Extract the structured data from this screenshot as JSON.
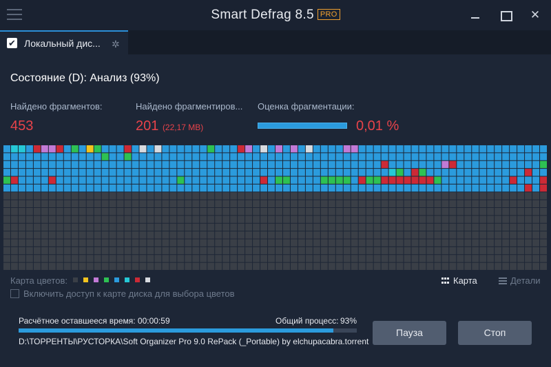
{
  "window": {
    "title": "Smart Defrag 8.5",
    "badge": "PRO",
    "close_glyph": "✕"
  },
  "tab": {
    "label": "Локальный дис...",
    "checked_glyph": "✔",
    "spinner_glyph": "✲"
  },
  "status": "Состояние (D): Анализ (93%)",
  "stats": {
    "fragments_label": "Найдено фрагментов:",
    "fragments_value": "453",
    "fragmented_label": "Найдено фрагментиров...",
    "fragmented_value": "201",
    "fragmented_size": "(22,17 MB)",
    "rating_label": "Оценка фрагментации:",
    "rating_value": "0,01 %"
  },
  "disk_map": {
    "columns": 72,
    "rows": 16,
    "colors": {
      "empty": "#3a3f47",
      "used": "#2b9bdd",
      "fragmented": "#cc2a36",
      "optimized": "#2ec153",
      "system": "#c27ad6",
      "mft": "#26c8d6",
      "locked": "#f2c31f",
      "unmovable": "#d8dbe0"
    },
    "filled_rows": 6,
    "highlights": [
      [
        0,
        1,
        "mft"
      ],
      [
        0,
        2,
        "mft"
      ],
      [
        0,
        3,
        "used"
      ],
      [
        0,
        4,
        "fragmented"
      ],
      [
        0,
        5,
        "system"
      ],
      [
        0,
        6,
        "system"
      ],
      [
        0,
        7,
        "fragmented"
      ],
      [
        0,
        9,
        "optimized"
      ],
      [
        0,
        10,
        "used"
      ],
      [
        0,
        11,
        "locked"
      ],
      [
        0,
        12,
        "optimized"
      ],
      [
        0,
        16,
        "fragmented"
      ],
      [
        0,
        18,
        "unmovable"
      ],
      [
        0,
        20,
        "unmovable"
      ],
      [
        0,
        27,
        "optimized"
      ],
      [
        0,
        31,
        "fragmented"
      ],
      [
        0,
        32,
        "system"
      ],
      [
        0,
        34,
        "unmovable"
      ],
      [
        0,
        36,
        "system"
      ],
      [
        0,
        38,
        "system"
      ],
      [
        0,
        40,
        "unmovable"
      ],
      [
        0,
        45,
        "system"
      ],
      [
        0,
        46,
        "system"
      ],
      [
        1,
        13,
        "optimized"
      ],
      [
        1,
        16,
        "optimized"
      ],
      [
        2,
        50,
        "fragmented"
      ],
      [
        2,
        58,
        "system"
      ],
      [
        2,
        59,
        "fragmented"
      ],
      [
        2,
        71,
        "optimized"
      ],
      [
        3,
        51,
        "mft"
      ],
      [
        3,
        52,
        "optimized"
      ],
      [
        3,
        54,
        "fragmented"
      ],
      [
        3,
        55,
        "optimized"
      ],
      [
        3,
        69,
        "fragmented"
      ],
      [
        4,
        0,
        "optimized"
      ],
      [
        4,
        1,
        "fragmented"
      ],
      [
        4,
        6,
        "fragmented"
      ],
      [
        4,
        23,
        "optimized"
      ],
      [
        4,
        34,
        "fragmented"
      ],
      [
        4,
        36,
        "optimized"
      ],
      [
        4,
        37,
        "optimized"
      ],
      [
        4,
        42,
        "optimized"
      ],
      [
        4,
        43,
        "optimized"
      ],
      [
        4,
        44,
        "optimized"
      ],
      [
        4,
        45,
        "optimized"
      ],
      [
        4,
        47,
        "fragmented"
      ],
      [
        4,
        48,
        "optimized"
      ],
      [
        4,
        49,
        "optimized"
      ],
      [
        4,
        50,
        "fragmented"
      ],
      [
        4,
        51,
        "fragmented"
      ],
      [
        4,
        52,
        "fragmented"
      ],
      [
        4,
        53,
        "fragmented"
      ],
      [
        4,
        54,
        "fragmented"
      ],
      [
        4,
        55,
        "fragmented"
      ],
      [
        4,
        56,
        "fragmented"
      ],
      [
        4,
        57,
        "optimized"
      ],
      [
        4,
        67,
        "fragmented"
      ],
      [
        4,
        71,
        "fragmented"
      ],
      [
        5,
        69,
        "fragmented"
      ],
      [
        5,
        71,
        "fragmented"
      ]
    ]
  },
  "legend": {
    "label": "Карта цветов:",
    "swatches": [
      "#3a3f47",
      "#f2c31f",
      "#c27ad6",
      "#2ec153",
      "#2b9bdd",
      "#26c8d6",
      "#cc2a36",
      "#d8dbe0"
    ]
  },
  "view": {
    "map_label": "Карта",
    "details_label": "Детали"
  },
  "color_access_label": "Включить доступ к карте диска для выбора цветов",
  "progress": {
    "remaining_label": "Расчётное оставшееся время:  00:00:59",
    "overall_label": "Общий процесс:",
    "overall_percent": "93%",
    "fraction": 0.93,
    "current_file": "D:\\ТОРРЕНТЫ\\РУСТОРКА\\Soft Organizer Pro 9.0 RePack (_Portable) by elchupacabra.torrent"
  },
  "buttons": {
    "pause": "Пауза",
    "stop": "Стоп"
  }
}
